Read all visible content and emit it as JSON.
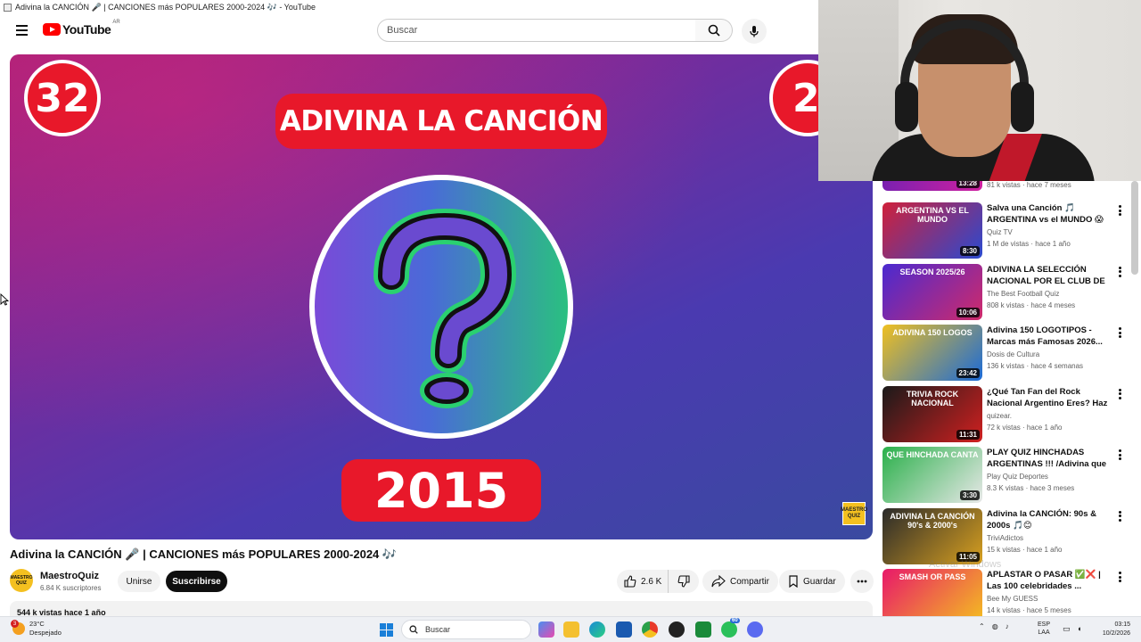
{
  "window": {
    "title": "Adivina la CANCIÓN 🎤 | CANCIONES más POPULARES 2000-2024 🎶 - YouTube"
  },
  "header": {
    "logo_text": "YouTube",
    "country_code": "AR",
    "search_placeholder": "Buscar"
  },
  "video_thumbnail": {
    "counter_left": "32",
    "counter_right": "2",
    "banner_text": "ADIVINA LA CANCIÓN",
    "question_mark": "?",
    "year": "2015",
    "watermark": "MAESTRO QUIZ"
  },
  "video": {
    "title": "Adivina la CANCIÓN 🎤 | CANCIONES más POPULARES 2000-2024 🎶",
    "channel_name": "MaestroQuiz",
    "channel_avatar": "MAESTRO QUIZ",
    "subscribers": "6.84 K suscriptores",
    "join_label": "Unirse",
    "subscribe_label": "Suscribirse",
    "likes": "2.6 K",
    "share_label": "Compartir",
    "save_label": "Guardar",
    "views_partial": "544 k vistas  hace 1 año"
  },
  "sidebar": {
    "partial_item": {
      "duration": "13:28",
      "meta": "81 k vistas · hace 7 meses"
    },
    "items": [
      {
        "title": "Salva una Canción 🎵 ARGENTINA vs el MUNDO 😱 ...",
        "channel": "Quiz TV",
        "meta": "1 M de vistas · hace 1 año",
        "duration": "8:30",
        "thumb_label": "ARGENTINA VS EL MUNDO",
        "colors": [
          "#d0203a",
          "#2a4ad0"
        ]
      },
      {
        "title": "ADIVINA LA SELECCIÓN NACIONAL POR EL CLUB DE ...",
        "channel": "The Best Football Quiz",
        "meta": "808 k vistas · hace 4 meses",
        "duration": "10:06",
        "thumb_label": "SEASON 2025/26",
        "colors": [
          "#4a2ad0",
          "#d02a6a"
        ]
      },
      {
        "title": "Adivina 150 LOGOTIPOS - Marcas más Famosas 2026...",
        "channel": "Dosis de Cultura",
        "meta": "136 k vistas · hace 4 semanas",
        "duration": "23:42",
        "thumb_label": "ADIVINA 150 LOGOS",
        "colors": [
          "#f0c020",
          "#1a6ad8"
        ]
      },
      {
        "title": "¿Qué Tan Fan del Rock Nacional Argentino Eres? Haz Historia ...",
        "channel": "quizear.",
        "meta": "72 k vistas · hace 1 año",
        "duration": "11:31",
        "thumb_label": "TRIVIA ROCK NACIONAL",
        "colors": [
          "#1a1a1a",
          "#d02020"
        ]
      },
      {
        "title": "PLAY QUIZ HINCHADAS ARGENTINAS !!! /Adivina que ...",
        "channel": "Play Quiz Deportes",
        "meta": "8.3 K vistas · hace 3 meses",
        "duration": "3:30",
        "thumb_label": "QUE HINCHADA CANTA",
        "colors": [
          "#2ab04a",
          "#e8e8e8"
        ]
      },
      {
        "title": "Adivina la CANCIÓN: 90s & 2000s 🎵😊",
        "channel": "TriviAdictos",
        "meta": "15 k vistas · hace 1 año",
        "duration": "11:05",
        "thumb_label": "ADIVINA LA CANCIÓN 90's & 2000's",
        "colors": [
          "#2a2a2a",
          "#d8a020"
        ]
      },
      {
        "title": "APLASTAR O PASAR ✅❌ | Las 100 celebridades ...",
        "channel": "Bee My GUESS",
        "meta": "14 k vistas · hace 5 meses",
        "duration": "",
        "thumb_label": "SMASH OR PASS",
        "colors": [
          "#e8186a",
          "#f4c020"
        ]
      }
    ]
  },
  "overlay": {
    "activate_windows": "Activar Windows"
  },
  "taskbar": {
    "weather_temp": "23°C",
    "weather_desc": "Despejado",
    "weather_badge": "3",
    "search_label": "Buscar",
    "lang_line1": "ESP",
    "lang_line2": "LAA",
    "time": "03:15",
    "date": "10/2/2026",
    "badge_count": "60"
  },
  "colors": {
    "youtube_red": "#ff0000",
    "thumb_red": "#e8182a"
  }
}
